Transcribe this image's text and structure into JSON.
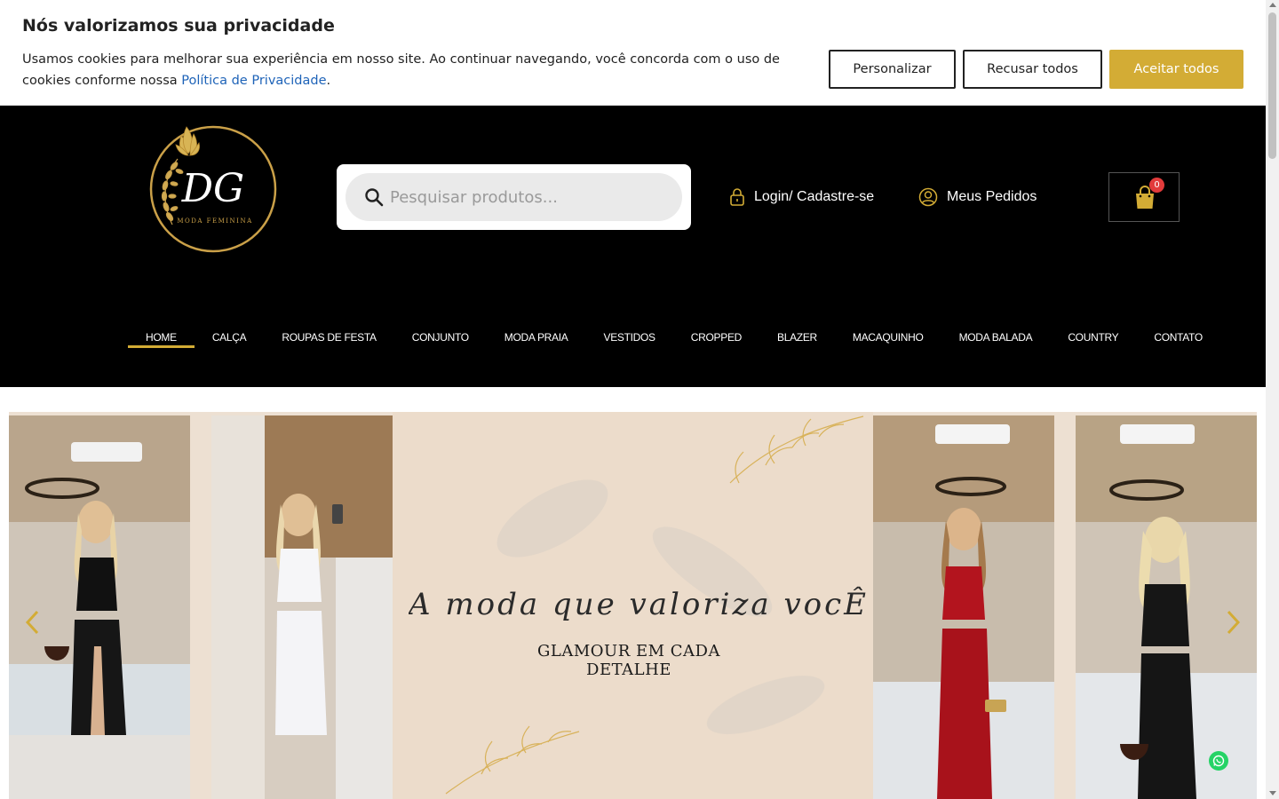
{
  "cookie": {
    "title": "Nós valorizamos sua privacidade",
    "text": "Usamos cookies para melhorar sua experiência em nosso site. Ao continuar navegando, você concorda com o uso de cookies conforme nossa ",
    "link": "Política de Privacidade",
    "text_end": ".",
    "buttons": {
      "customize": "Personalizar",
      "reject": "Recusar todos",
      "accept": "Aceitar todos"
    },
    "accent_color": "#d3ac35"
  },
  "header": {
    "logo_text": "DG",
    "logo_sub": "MODA FEMININA",
    "search_placeholder": "Pesquisar produtos...",
    "login": "Login/ Cadastre-se",
    "orders": "Meus Pedidos",
    "cart_count": "0"
  },
  "nav": {
    "items": [
      "HOME",
      "CALÇA",
      "ROUPAS DE FESTA",
      "CONJUNTO",
      "MODA PRAIA",
      "VESTIDOS",
      "CROPPED",
      "BLAZER",
      "MACAQUINHO",
      "MODA BALADA",
      "COUNTRY",
      "CONTATO"
    ]
  },
  "hero": {
    "script_text": "A moda que valoriza vocÊ",
    "subtitle": "GLAMOUR EM CADA DETALHE"
  }
}
